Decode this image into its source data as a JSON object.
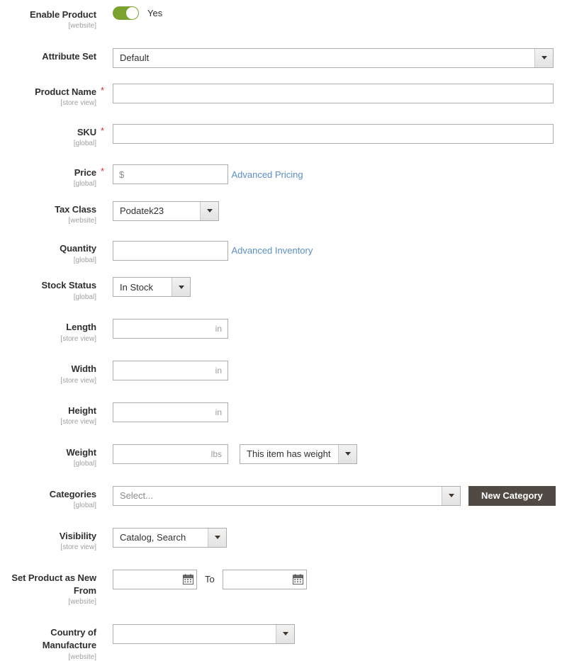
{
  "form": {
    "fields": [
      {
        "key": "enable_product",
        "label": "Enable Product",
        "scope": "[website]",
        "required": false,
        "type": "toggle",
        "toggle_state": "Yes"
      },
      {
        "key": "attribute_set",
        "label": "Attribute Set",
        "scope": "",
        "required": false,
        "type": "select",
        "value": "Default"
      },
      {
        "key": "product_name",
        "label": "Product Name",
        "scope": "[store view]",
        "required": true,
        "type": "text",
        "value": "",
        "placeholder": ""
      },
      {
        "key": "sku",
        "label": "SKU",
        "scope": "[global]",
        "required": true,
        "type": "text",
        "value": "",
        "placeholder": ""
      },
      {
        "key": "price",
        "label": "Price",
        "scope": "[global]",
        "required": true,
        "type": "text",
        "value": "",
        "placeholder": "$",
        "link": "Advanced Pricing"
      },
      {
        "key": "tax_class",
        "label": "Tax Class",
        "scope": "[website]",
        "required": false,
        "type": "select",
        "value": "Podatek23"
      },
      {
        "key": "quantity",
        "label": "Quantity",
        "scope": "[global]",
        "required": false,
        "type": "text",
        "value": "",
        "placeholder": "",
        "link": "Advanced Inventory"
      },
      {
        "key": "stock_status",
        "label": "Stock Status",
        "scope": "[global]",
        "required": false,
        "type": "select",
        "value": "In Stock"
      },
      {
        "key": "length",
        "label": "Length",
        "scope": "[store view]",
        "required": false,
        "type": "text",
        "value": "",
        "unit": "in"
      },
      {
        "key": "width",
        "label": "Width",
        "scope": "[store view]",
        "required": false,
        "type": "text",
        "value": "",
        "unit": "in"
      },
      {
        "key": "height",
        "label": "Height",
        "scope": "[store view]",
        "required": false,
        "type": "text",
        "value": "",
        "unit": "in"
      },
      {
        "key": "weight",
        "label": "Weight",
        "scope": "[global]",
        "required": false,
        "type": "text_with_select",
        "value": "",
        "unit": "lbs",
        "select_value": "This item has weight"
      },
      {
        "key": "categories",
        "label": "Categories",
        "scope": "[global]",
        "required": false,
        "type": "select_with_button",
        "value": "Select...",
        "button_label": "New Category"
      },
      {
        "key": "visibility",
        "label": "Visibility",
        "scope": "[store view]",
        "required": false,
        "type": "select",
        "value": "Catalog, Search"
      },
      {
        "key": "set_product_as_new",
        "label": "Set Product as New From",
        "scope": "[website]",
        "required": false,
        "type": "date_range",
        "from_value": "",
        "to_label": "To",
        "to_value": ""
      },
      {
        "key": "country_of_manufacture",
        "label": "Country of Manufacture",
        "scope": "[website]",
        "required": false,
        "type": "select",
        "value": ""
      }
    ]
  },
  "colors": {
    "toggle_on": "#79a22e",
    "required_star": "#e02b27",
    "link": "#5a8fc4",
    "button_primary": "#514943",
    "label_text": "#303030",
    "scope_text": "#a0a0a0",
    "input_border": "#adadad"
  },
  "icons": {
    "calendar": "calendar-icon",
    "caret": "chevron-down-icon"
  }
}
